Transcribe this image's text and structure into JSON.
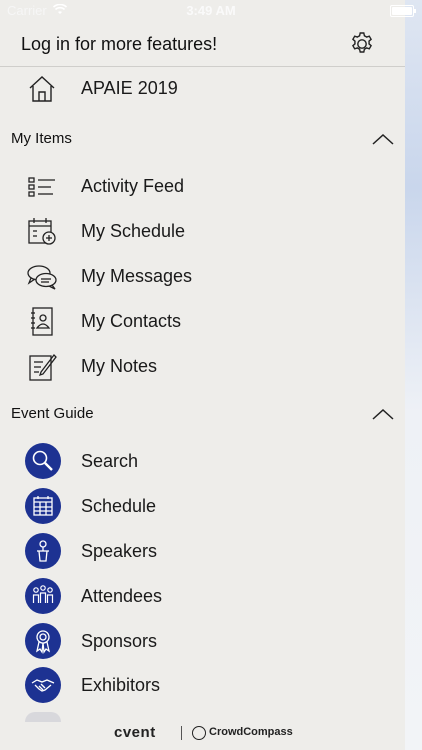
{
  "statusbar": {
    "carrier": "Carrier",
    "time": "3:49 AM"
  },
  "header": {
    "login_text": "Log in for more features!"
  },
  "home": {
    "label": "APAIE 2019"
  },
  "my_items": {
    "title": "My Items",
    "items": [
      {
        "label": "Activity Feed",
        "icon": "activity-feed-icon"
      },
      {
        "label": "My Schedule",
        "icon": "calendar-add-icon"
      },
      {
        "label": "My Messages",
        "icon": "messages-icon"
      },
      {
        "label": "My Contacts",
        "icon": "contacts-icon"
      },
      {
        "label": "My Notes",
        "icon": "notes-icon"
      }
    ]
  },
  "event_guide": {
    "title": "Event Guide",
    "items": [
      {
        "label": "Search",
        "icon": "search-icon"
      },
      {
        "label": "Schedule",
        "icon": "schedule-icon"
      },
      {
        "label": "Speakers",
        "icon": "speakers-icon"
      },
      {
        "label": "Attendees",
        "icon": "attendees-icon"
      },
      {
        "label": "Sponsors",
        "icon": "sponsors-icon"
      },
      {
        "label": "Exhibitors",
        "icon": "exhibitors-icon"
      }
    ]
  },
  "footer": {
    "brand": "cvent",
    "partner": "CrowdCompass"
  },
  "colors": {
    "accent": "#1d3292",
    "background": "#eeedea"
  }
}
